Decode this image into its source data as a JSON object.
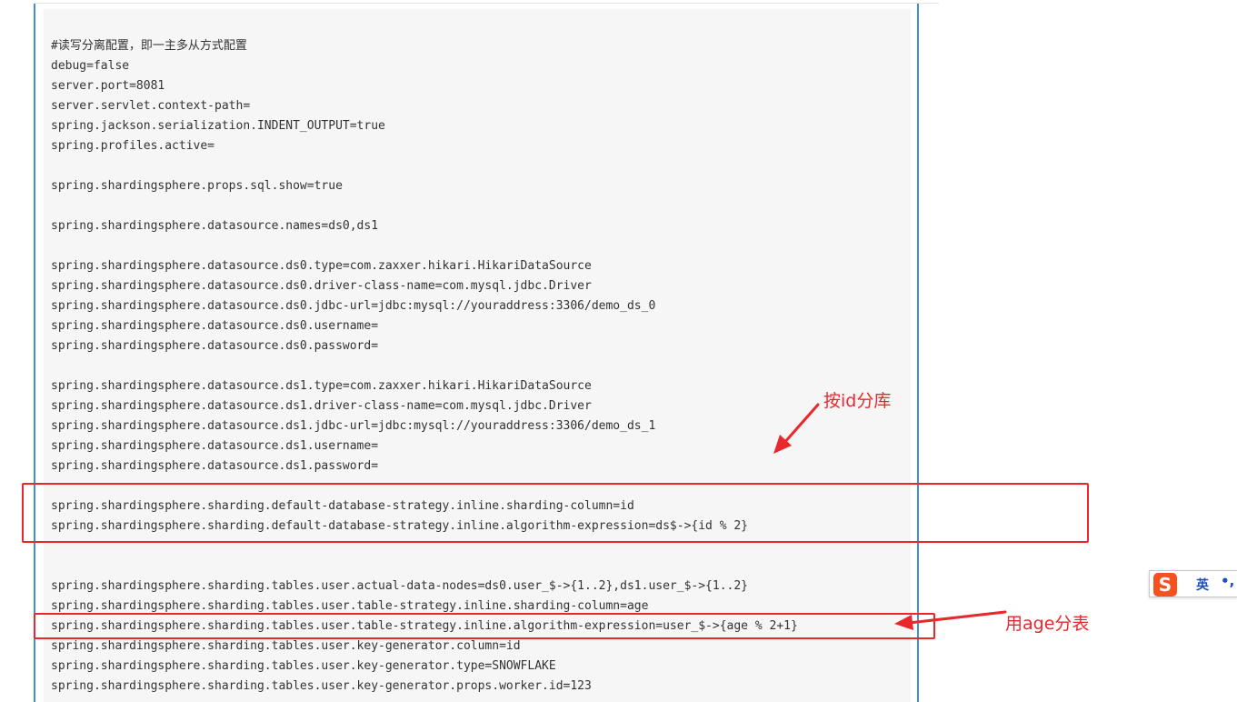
{
  "code": {
    "lines": [
      "#读写分离配置，即一主多从方式配置",
      "debug=false",
      "server.port=8081",
      "server.servlet.context-path=",
      "spring.jackson.serialization.INDENT_OUTPUT=true",
      "spring.profiles.active=",
      "",
      "spring.shardingsphere.props.sql.show=true",
      "",
      "spring.shardingsphere.datasource.names=ds0,ds1",
      "",
      "spring.shardingsphere.datasource.ds0.type=com.zaxxer.hikari.HikariDataSource",
      "spring.shardingsphere.datasource.ds0.driver-class-name=com.mysql.jdbc.Driver",
      "spring.shardingsphere.datasource.ds0.jdbc-url=jdbc:mysql://youraddress:3306/demo_ds_0",
      "spring.shardingsphere.datasource.ds0.username=",
      "spring.shardingsphere.datasource.ds0.password=",
      "",
      "spring.shardingsphere.datasource.ds1.type=com.zaxxer.hikari.HikariDataSource",
      "spring.shardingsphere.datasource.ds1.driver-class-name=com.mysql.jdbc.Driver",
      "spring.shardingsphere.datasource.ds1.jdbc-url=jdbc:mysql://youraddress:3306/demo_ds_1",
      "spring.shardingsphere.datasource.ds1.username=",
      "spring.shardingsphere.datasource.ds1.password=",
      "",
      "spring.shardingsphere.sharding.default-database-strategy.inline.sharding-column=id",
      "spring.shardingsphere.sharding.default-database-strategy.inline.algorithm-expression=ds$->{id % 2}",
      "",
      "",
      "spring.shardingsphere.sharding.tables.user.actual-data-nodes=ds0.user_$->{1..2},ds1.user_$->{1..2}",
      "spring.shardingsphere.sharding.tables.user.table-strategy.inline.sharding-column=age",
      "spring.shardingsphere.sharding.tables.user.table-strategy.inline.algorithm-expression=user_$->{age % 2+1}",
      "spring.shardingsphere.sharding.tables.user.key-generator.column=id",
      "spring.shardingsphere.sharding.tables.user.key-generator.type=SNOWFLAKE",
      "spring.shardingsphere.sharding.tables.user.key-generator.props.worker.id=123"
    ]
  },
  "annotations": {
    "db_sharding": "按id分库",
    "table_sharding": "用age分表"
  },
  "ime": {
    "logo": "S",
    "language": "英",
    "punctuation": "•,"
  },
  "colors": {
    "annotation": "#e8282b",
    "article_border": "#3d8fe0",
    "code_background": "#f6f6f6",
    "ime_logo": "#f4511e"
  },
  "icons": {
    "ime_logo": "sogou-ime-icon",
    "arrow": "red-arrow-icon"
  }
}
